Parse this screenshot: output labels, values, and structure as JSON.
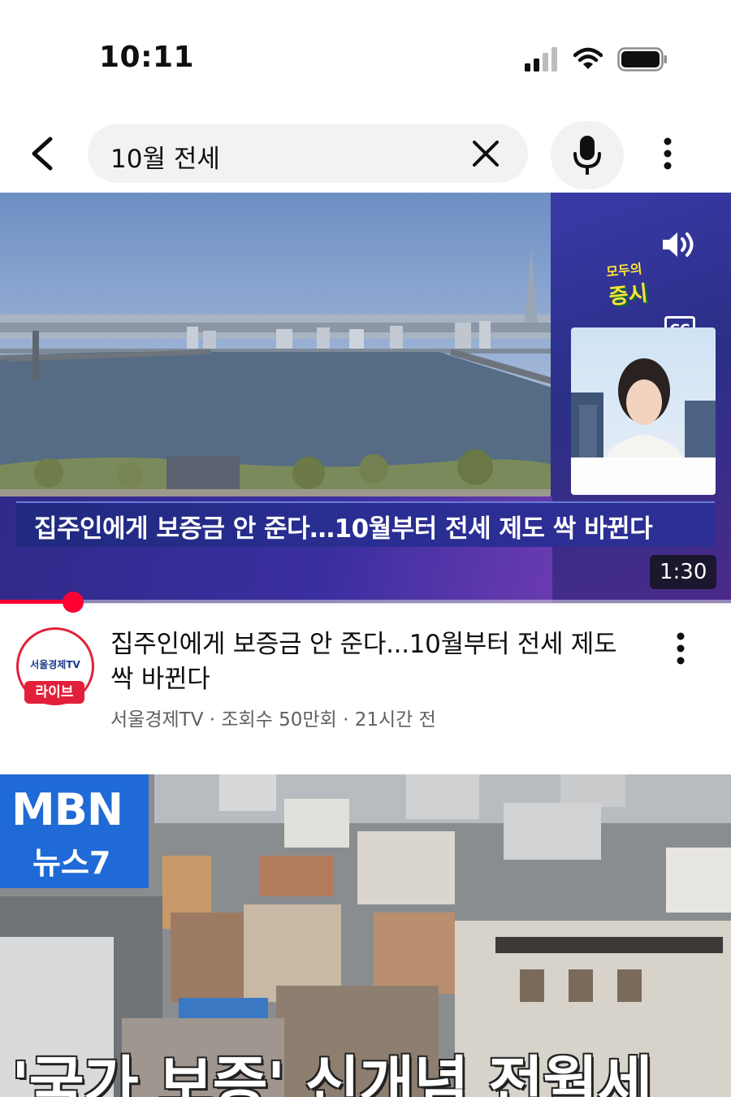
{
  "status_bar": {
    "time": "10:11"
  },
  "search": {
    "query": "10월 전세"
  },
  "player": {
    "overlay_title": "집주인에게 보증금 안 준다…10월부터 전세 제도 싹 바뀐다",
    "show_logo_top": "모두의",
    "show_logo_main": "증시",
    "cc_label": "CC",
    "duration": "1:30",
    "progress_fraction": 0.1
  },
  "video": {
    "title": "집주인에게 보증금 안 준다...10월부터 전세 제도 싹 바뀐다",
    "channel": "서울경제TV",
    "views": "조회수 50만회",
    "age": "21시간 전",
    "separator": "·",
    "avatar_name": "서울경제TV",
    "avatar_badge": "라이브"
  },
  "thumbnail2": {
    "logo_brand": "MBN",
    "logo_program": "뉴스7",
    "caption": "'국가 보증' 신개념 전월세"
  },
  "colors": {
    "accent_red": "#ff0033",
    "mbn_blue": "#1f6ad6",
    "meta_gray": "#606060"
  }
}
